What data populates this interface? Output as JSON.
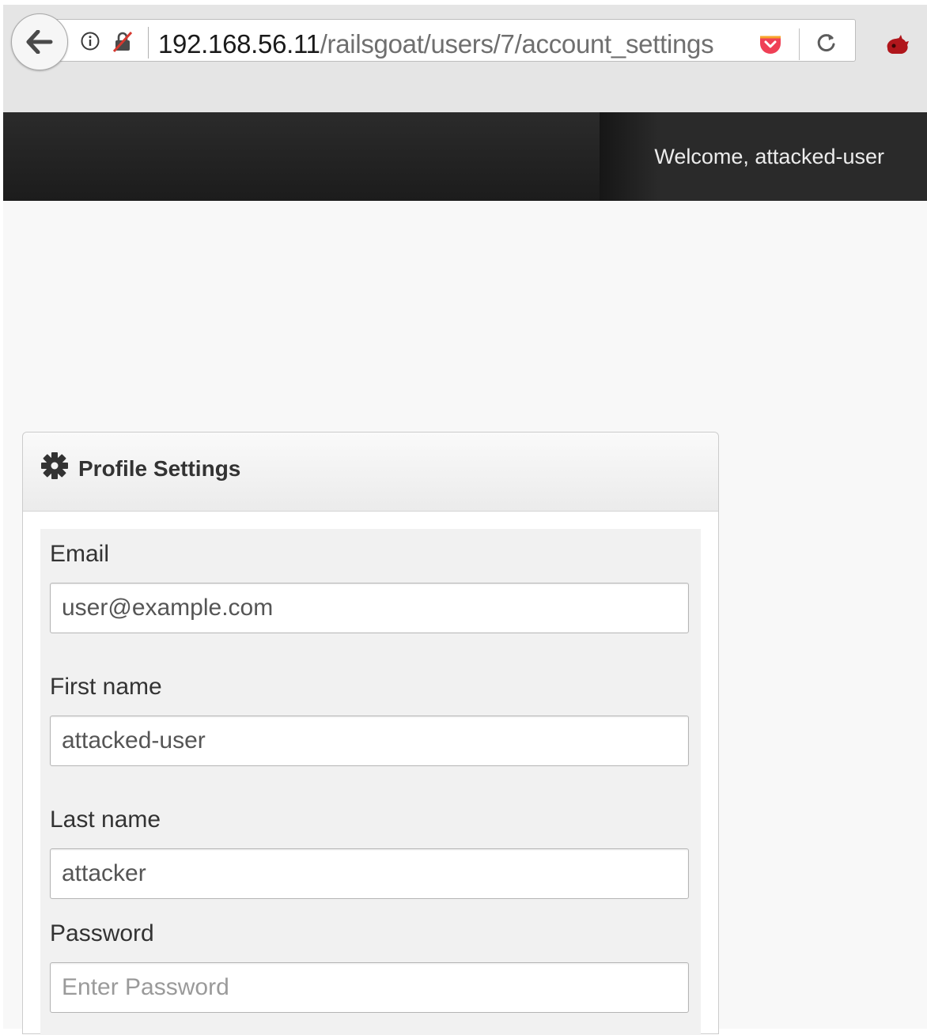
{
  "browser": {
    "url_host": "192.168.56.11",
    "url_path": "/railsgoat/users/7/account_settings"
  },
  "navbar": {
    "welcome": "Welcome, attacked-user"
  },
  "panel": {
    "title": "Profile Settings",
    "icon": "gear-icon"
  },
  "form": {
    "email_label": "Email",
    "email_value": "user@example.com",
    "first_name_label": "First name",
    "first_name_value": "attacked-user",
    "last_name_label": "Last name",
    "last_name_value": "attacker",
    "password_label": "Password",
    "password_placeholder": "Enter Password"
  },
  "colors": {
    "navbar": "#222222",
    "page_background": "#f8f8f8",
    "extension_red": "#b0161c"
  }
}
